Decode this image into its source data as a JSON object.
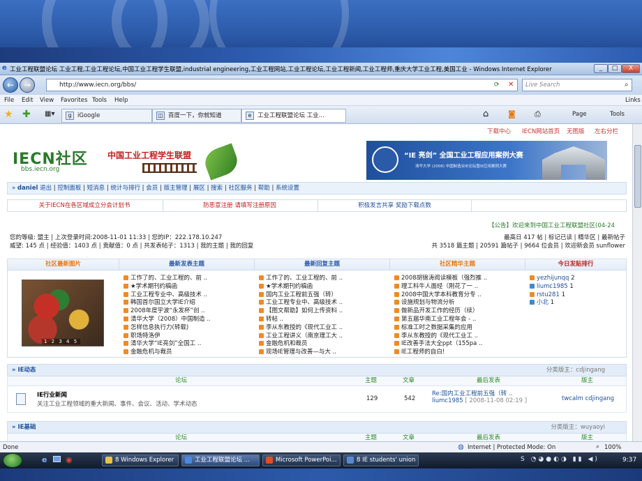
{
  "window": {
    "title": "工业工程联盟论坛 工业工程,工业工程论坛,中国工业工程学生联盟,industrial engineering,工业工程网站,工业工程论坛,工业工程新闻,工业工程师,重庆大学工业工程,美国工业 - Windows Internet Explorer",
    "minimize": "_",
    "maximize": "□",
    "close": "X"
  },
  "address": {
    "url": "http://www.iecn.org/bbs/",
    "search_placeholder": "Live Search"
  },
  "menu": [
    "File",
    "Edit",
    "View",
    "Favorites",
    "Tools",
    "Help"
  ],
  "menu_right": "Links",
  "tabs": [
    {
      "label": "iGoogle"
    },
    {
      "label": "百度一下，你就知道"
    },
    {
      "label": "工业工程联盟论坛 工业..."
    }
  ],
  "toolbar": {
    "page": "Page",
    "tools": "Tools"
  },
  "page": {
    "top_links": [
      "下载中心",
      "IECN网站首页",
      "无图版",
      "左右分栏"
    ],
    "logo_main": "IECN社区",
    "logo_url": "bbs.iecn.org",
    "logo_tagline": "中国工业工程学生联盟",
    "banner_text": "“IE 亮剑” 全国工业工程应用案例大赛",
    "banner_sub": "清华大学 (2008) 中国制造业IE论坛暨IE应用案例大赛",
    "user_nav": [
      "daniel",
      "退出",
      "控制面板",
      "短消息",
      "统计与排行",
      "会员",
      "版主管理",
      "展区",
      "搜索",
      "社区服务",
      "帮助",
      "系统设置"
    ],
    "notices": [
      "关于IECN在各区域成立分会计划书",
      "防恶意注册 请填写注册原因",
      "积极发言共享 奖励下载点数"
    ],
    "announce": "【公告】欢迎来到中国工业工程联盟社区(04-24",
    "user_line1": "您的等级: 盟主 | 上次登录时间:2008-11-01 11:33 | 您的IP：222.178.10.247",
    "user_line2": "威望: 145 点 | 经验值：1403 点 | 贡献值：0 点 | 共发表帖子：1313 | 我的主题 | 我的回复",
    "stats_line1": "最高日 417 帖 | 标记已读 | 精华区 | 最新帖子",
    "stats_line2": "共 3518 篇主题 | 20591 篇帖子 | 9664 位会员 | 欢迎新会员 sunflower",
    "panel_titles": [
      "社区最新图片",
      "最新发表主题",
      "最新回复主题",
      "社区精华主题",
      "今日发贴排行"
    ],
    "photo_pager": "1 2 3 4 5",
    "latest_posts": [
      "工作了的、工业工程的、前 ..",
      "★学术期刊约稿函",
      "工业工程专业中、高级技术 ..",
      "韩国首尔国立大学IE介绍",
      "2008年度宇波“永发杯”创 ..",
      "清华大学（2008）中国制造 ..",
      "怎样信息执行力(转载)",
      "职场特洛伊",
      "清华大学“IE亮剑”全国工 ..",
      "金融危机与裁员"
    ],
    "latest_replies": [
      "工作了的、工业工程的、前 ..",
      "★学术期刊约稿函",
      "国内工业工程前五强（转）",
      "工业工程专业中、高级技术 ..",
      "【图文帮助】如何上传资料 ..",
      "转帖 ..",
      "李从东教授的《现代工业工 ..",
      "工业工程讲义（南京理工大 ..",
      "金融危机和裁员",
      "现场IE管理与改善—与大 .."
    ],
    "elite_posts": [
      "2008胡锦涛阅读模板（强烈推 ..",
      "理工科牛人面经（刚花了一 ..",
      "2008中国大学本科教育分专 ..",
      "设施规划与物流分析",
      "做新品开发工作的经历（续）",
      "第五届华南工业工程年会 - ..",
      "标准工时之数据采集的应用",
      "李从东教授的《现代工业工 ..",
      "IE改善手法大全ppt（155pa ..",
      "IE工程师的自白!"
    ],
    "ranking": [
      {
        "name": "yezhijunqq",
        "count": "2"
      },
      {
        "name": "liumc1985",
        "count": "1"
      },
      {
        "name": "rstu281",
        "count": "1"
      },
      {
        "name": "小北",
        "count": "1"
      }
    ],
    "sections": [
      {
        "title": "» IE动态",
        "moderator": "分类版主：cdjingang"
      },
      {
        "title": "» IE基础",
        "moderator": "分类版主：wuyaoyi"
      }
    ],
    "columns": [
      "论坛",
      "主题",
      "文章",
      "最后发表",
      "版主"
    ],
    "forum": {
      "name": "IE行业新闻",
      "desc": "关注工业工程领域的重大新闻、事件、会议、活动、学术动态",
      "topics": "129",
      "posts": "542",
      "last_title": "Re:国内工业工程前五强（转 ..",
      "last_by": "liumc1985",
      "last_time": "[ 2008-11-08 02:19 ]",
      "moderators": "twcalm cdjingang"
    }
  },
  "status": {
    "left": "Done",
    "zone": "Internet | Protected Mode: On",
    "zoom": "100%"
  },
  "taskbar": {
    "items": [
      "8 Windows Explorer",
      "工业工程联盟论坛 ...",
      "Microsoft PowerPoi...",
      "8 IE students' union ..."
    ],
    "clock": "9:37"
  },
  "colors": {
    "accent": "#1d4f9a",
    "brand_green": "#2a8a2a",
    "alert_red": "#c02020",
    "bullet": "#f08a24"
  }
}
